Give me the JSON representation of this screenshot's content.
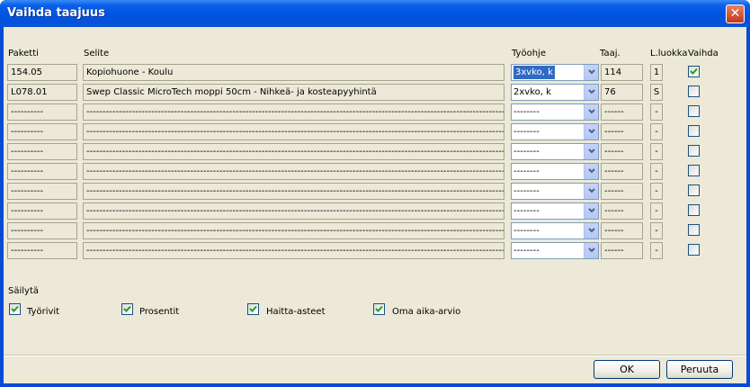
{
  "window": {
    "title": "Vaihda taajuus",
    "close_label": "✕"
  },
  "headers": {
    "paketti": "Paketti",
    "selite": "Selite",
    "tyoohje": "Työohje",
    "taaj": "Taaj.",
    "luokka": "L.luokka",
    "vaihda": "Vaihda"
  },
  "rows": [
    {
      "paketti": "154.05",
      "selite": "Kopiohuone - Koulu",
      "tyoohje": "3xvko, k",
      "taaj": "114",
      "luokka": "1",
      "vaihda": true,
      "tyoohje_selected": true
    },
    {
      "paketti": "L078.01",
      "selite": "Swep Classic MicroTech moppi 50cm - Nihkeä- ja kosteapyyhintä",
      "tyoohje": "2xvko, k",
      "taaj": "76",
      "luokka": "S",
      "vaihda": false,
      "tyoohje_selected": false
    },
    {
      "paketti": "----------",
      "selite": "-------------------------------------------------------------------------------------------------------------------------------------------------------------------------",
      "tyoohje": "--------",
      "taaj": "------",
      "luokka": "-",
      "vaihda": false,
      "tyoohje_selected": false
    },
    {
      "paketti": "----------",
      "selite": "-------------------------------------------------------------------------------------------------------------------------------------------------------------------------",
      "tyoohje": "--------",
      "taaj": "------",
      "luokka": "-",
      "vaihda": false,
      "tyoohje_selected": false
    },
    {
      "paketti": "----------",
      "selite": "-------------------------------------------------------------------------------------------------------------------------------------------------------------------------",
      "tyoohje": "--------",
      "taaj": "------",
      "luokka": "-",
      "vaihda": false,
      "tyoohje_selected": false
    },
    {
      "paketti": "----------",
      "selite": "-------------------------------------------------------------------------------------------------------------------------------------------------------------------------",
      "tyoohje": "--------",
      "taaj": "------",
      "luokka": "-",
      "vaihda": false,
      "tyoohje_selected": false
    },
    {
      "paketti": "----------",
      "selite": "-------------------------------------------------------------------------------------------------------------------------------------------------------------------------",
      "tyoohje": "--------",
      "taaj": "------",
      "luokka": "-",
      "vaihda": false,
      "tyoohje_selected": false
    },
    {
      "paketti": "----------",
      "selite": "-------------------------------------------------------------------------------------------------------------------------------------------------------------------------",
      "tyoohje": "--------",
      "taaj": "------",
      "luokka": "-",
      "vaihda": false,
      "tyoohje_selected": false
    },
    {
      "paketti": "----------",
      "selite": "-------------------------------------------------------------------------------------------------------------------------------------------------------------------------",
      "tyoohje": "--------",
      "taaj": "------",
      "luokka": "-",
      "vaihda": false,
      "tyoohje_selected": false
    },
    {
      "paketti": "----------",
      "selite": "-------------------------------------------------------------------------------------------------------------------------------------------------------------------------",
      "tyoohje": "--------",
      "taaj": "------",
      "luokka": "-",
      "vaihda": false,
      "tyoohje_selected": false
    }
  ],
  "sailyta": {
    "label": "Säilytä",
    "options": [
      {
        "label": "Työrivit",
        "checked": true
      },
      {
        "label": "Prosentit",
        "checked": true
      },
      {
        "label": "Haitta-asteet",
        "checked": true
      },
      {
        "label": "Oma aika-arvio",
        "checked": true
      }
    ]
  },
  "buttons": {
    "ok": "OK",
    "cancel": "Peruuta"
  },
  "colors": {
    "title_bar": "#0053e0",
    "dialog_bg": "#ece9d8",
    "selection": "#316ac5",
    "check": "#21a121"
  }
}
